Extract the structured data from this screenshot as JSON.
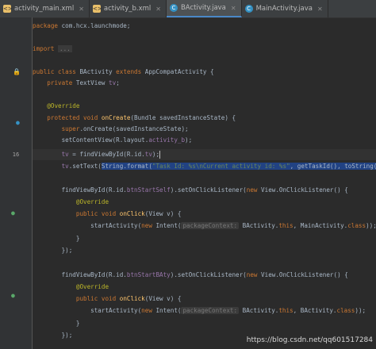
{
  "tabs": [
    {
      "label": "activity_main.xml",
      "type": "xml",
      "active": false
    },
    {
      "label": "activity_b.xml",
      "type": "xml",
      "active": false
    },
    {
      "label": "BActivity.java",
      "type": "java",
      "active": true
    },
    {
      "label": "MainActivity.java",
      "type": "java",
      "active": false
    }
  ],
  "gutter": {
    "visible_line_number": "16"
  },
  "code": {
    "l1_kw": "package",
    "l1_rest": " com.hcx.launchmode;",
    "l2_kw": "import",
    "l2_fold": "...",
    "l3_kw1": "public class",
    "l3_name": " BActivity ",
    "l3_kw2": "extends",
    "l3_rest": " AppCompatActivity {",
    "l4_kw": "private",
    "l4_type": " TextView ",
    "l4_field": "tv",
    "l4_end": ";",
    "l5_ann": "@Override",
    "l6_kw": "protected void",
    "l6_mth": " onCreate",
    "l6_rest": "(Bundle savedInstanceState) {",
    "l7_kw": "super",
    "l7_rest": ".onCreate(savedInstanceState);",
    "l8_pre": "setContentView(R.layout.",
    "l8_fld": "activity_b",
    "l8_end": ");",
    "l9_fld": "tv",
    "l9_mid": " = findViewById(R.id.",
    "l9_fld2": "tv",
    "l9_end": ");",
    "l10_fld": "tv",
    "l10_pre": ".setText(",
    "l10_sel1": "String.format(",
    "l10_str": "\"Task Id: %s\\nCurrent activity id: %s\"",
    "l10_sel2": ", getTaskId(), toString())",
    "l10_end": ");",
    "l11_pre": "findViewById(R.id.",
    "l11_fld": "btnStartSelf",
    "l11_mid": ").setOnClickListener(",
    "l11_kw": "new",
    "l11_end": " View.OnClickListener() {",
    "l12_ann": "@Override",
    "l13_kw": "public void",
    "l13_mth": " onClick",
    "l13_rest": "(View v) {",
    "l14_pre": "startActivity(",
    "l14_kw": "new",
    "l14_mid": " Intent(",
    "l14_hint": "packageContext:",
    "l14_a": " BActivity.",
    "l14_kw2": "this",
    "l14_b": ", MainActivity.",
    "l14_kw3": "class",
    "l14_end": "));",
    "l15": "}",
    "l16": "});",
    "l17_pre": "findViewById(R.id.",
    "l17_fld": "btnStartBAty",
    "l17_mid": ").setOnClickListener(",
    "l17_kw": "new",
    "l17_end": " View.OnClickListener() {",
    "l18_ann": "@Override",
    "l19_kw": "public void",
    "l19_mth": " onClick",
    "l19_rest": "(View v) {",
    "l20_pre": "startActivity(",
    "l20_kw": "new",
    "l20_mid": " Intent(",
    "l20_hint": "packageContext:",
    "l20_a": " BActivity.",
    "l20_kw2": "this",
    "l20_b": ", BActivity.",
    "l20_kw3": "class",
    "l20_end": "));",
    "l21": "}",
    "l22": "});"
  },
  "watermark": "https://blog.csdn.net/qq601517284",
  "colors": {
    "background": "#2b2b2b",
    "keyword": "#cc7832",
    "string": "#6a8759",
    "field": "#9876aa",
    "annotation": "#bbb529",
    "method": "#ffc66d",
    "selection": "#214283"
  }
}
